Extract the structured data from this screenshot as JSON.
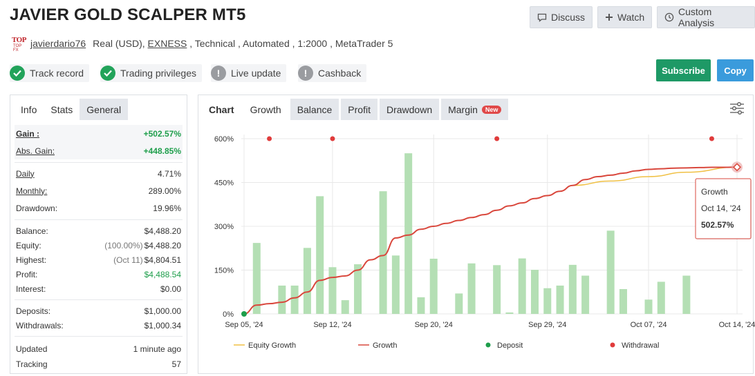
{
  "title": "JAVIER GOLD SCALPER MT5",
  "top_buttons": {
    "discuss": "Discuss",
    "watch": "Watch",
    "custom_analysis": "Custom Analysis"
  },
  "meta": {
    "logo_top": "TOP",
    "logo_bottom": "TOP FX",
    "username": "javierdario76",
    "account_type": "Real (USD), ",
    "broker": "EXNESS",
    "details": " , Technical , Automated , 1:2000 , MetaTrader 5"
  },
  "badges": [
    {
      "label": "Track record",
      "status": "check"
    },
    {
      "label": "Trading privileges",
      "status": "check"
    },
    {
      "label": "Live update",
      "status": "warning"
    },
    {
      "label": "Cashback",
      "status": "warning"
    }
  ],
  "actions": {
    "subscribe": "Subscribe",
    "copy": "Copy"
  },
  "left_tabs": [
    "Info",
    "Stats",
    "General"
  ],
  "stats": {
    "gain_label": "Gain :",
    "gain_value": "+502.57%",
    "abs_gain_label": "Abs. Gain:",
    "abs_gain_value": "+448.85%",
    "daily_label": "Daily",
    "daily_value": "4.71%",
    "monthly_label": "Monthly:",
    "monthly_value": "289.00%",
    "drawdown_label": "Drawdown:",
    "drawdown_value": "19.96%",
    "balance_label": "Balance:",
    "balance_value": "$4,488.20",
    "equity_label": "Equity:",
    "equity_pct": "(100.00%)",
    "equity_value": "$4,488.20",
    "highest_label": "Highest:",
    "highest_date": "(Oct 11)",
    "highest_value": "$4,804.51",
    "profit_label": "Profit:",
    "profit_value": "$4,488.54",
    "interest_label": "Interest:",
    "interest_value": "$0.00",
    "deposits_label": "Deposits:",
    "deposits_value": "$1,000.00",
    "withdrawals_label": "Withdrawals:",
    "withdrawals_value": "$1,000.34",
    "updated_label": "Updated",
    "updated_value": "1 minute ago",
    "tracking_label": "Tracking",
    "tracking_value": "57"
  },
  "chart_tabs": [
    "Chart",
    "Growth",
    "Balance",
    "Profit",
    "Drawdown",
    "Margin"
  ],
  "chart_tab_new_badge": "New",
  "tooltip": {
    "title": "Growth",
    "date": "Oct 14, '24",
    "value": "502.57%"
  },
  "colors": {
    "growth_line": "#d9473c",
    "equity_line": "#f0c043",
    "bars": "#b4dfb4",
    "deposit": "#1e9e4b",
    "withdrawal": "#e03b3b",
    "subscribe": "#1e9966",
    "copy": "#3a9bdc"
  },
  "chart_data": {
    "type": "line",
    "ylim": [
      0,
      600
    ],
    "yticks": [
      "0%",
      "150%",
      "300%",
      "450%",
      "600%"
    ],
    "ytick_values": [
      0,
      150,
      300,
      450,
      600
    ],
    "xtick_labels": [
      "Sep 05, '24",
      "Sep 12, '24",
      "Sep 20, '24",
      "Sep 29, '24",
      "Oct 07, '24",
      "Oct 14, '24"
    ],
    "x_start_label": "Sep 05, '24",
    "x_end_label": "Oct 14, '24",
    "legend": [
      "Equity Growth",
      "Growth",
      "Deposit",
      "Withdrawal"
    ],
    "bars": [
      {
        "date": "Sep 06, '24",
        "value": 243
      },
      {
        "date": "Sep 08, '24",
        "value": 97
      },
      {
        "date": "Sep 09, '24",
        "value": 97
      },
      {
        "date": "Sep 10, '24",
        "value": 226
      },
      {
        "date": "Sep 11, '24",
        "value": 403
      },
      {
        "date": "Sep 12, '24",
        "value": 160
      },
      {
        "date": "Sep 13, '24",
        "value": 47
      },
      {
        "date": "Sep 14, '24",
        "value": 170
      },
      {
        "date": "Sep 16, '24",
        "value": 420
      },
      {
        "date": "Sep 17, '24",
        "value": 200
      },
      {
        "date": "Sep 18, '24",
        "value": 550
      },
      {
        "date": "Sep 19, '24",
        "value": 57
      },
      {
        "date": "Sep 20, '24",
        "value": 189
      },
      {
        "date": "Sep 22, '24",
        "value": 70
      },
      {
        "date": "Sep 23, '24",
        "value": 173
      },
      {
        "date": "Sep 25, '24",
        "value": 167
      },
      {
        "date": "Sep 26, '24",
        "value": 5
      },
      {
        "date": "Sep 27, '24",
        "value": 190
      },
      {
        "date": "Sep 28, '24",
        "value": 151
      },
      {
        "date": "Sep 29, '24",
        "value": 88
      },
      {
        "date": "Sep 30, '24",
        "value": 97
      },
      {
        "date": "Oct 01, '24",
        "value": 168
      },
      {
        "date": "Oct 02, '24",
        "value": 131
      },
      {
        "date": "Oct 04, '24",
        "value": 285
      },
      {
        "date": "Oct 05, '24",
        "value": 85
      },
      {
        "date": "Oct 07, '24",
        "value": 49
      },
      {
        "date": "Oct 08, '24",
        "value": 110
      },
      {
        "date": "Oct 10, '24",
        "value": 131
      }
    ],
    "growth": [
      [
        "Sep 05, '24",
        0
      ],
      [
        "Sep 06, '24",
        30
      ],
      [
        "Sep 07, '24",
        35
      ],
      [
        "Sep 08, '24",
        40
      ],
      [
        "Sep 09, '24",
        55
      ],
      [
        "Sep 10, '24",
        75
      ],
      [
        "Sep 11, '24",
        115
      ],
      [
        "Sep 12, '24",
        125
      ],
      [
        "Sep 13, '24",
        130
      ],
      [
        "Sep 14, '24",
        150
      ],
      [
        "Sep 15, '24",
        185
      ],
      [
        "Sep 16, '24",
        200
      ],
      [
        "Sep 17, '24",
        260
      ],
      [
        "Sep 18, '24",
        270
      ],
      [
        "Sep 19, '24",
        290
      ],
      [
        "Sep 20, '24",
        300
      ],
      [
        "Sep 21, '24",
        310
      ],
      [
        "Sep 22, '24",
        320
      ],
      [
        "Sep 23, '24",
        330
      ],
      [
        "Sep 24, '24",
        340
      ],
      [
        "Sep 25, '24",
        355
      ],
      [
        "Sep 26, '24",
        370
      ],
      [
        "Sep 27, '24",
        380
      ],
      [
        "Sep 28, '24",
        395
      ],
      [
        "Sep 29, '24",
        405
      ],
      [
        "Sep 30, '24",
        420
      ],
      [
        "Oct 01, '24",
        440
      ],
      [
        "Oct 02, '24",
        460
      ],
      [
        "Oct 03, '24",
        470
      ],
      [
        "Oct 04, '24",
        475
      ],
      [
        "Oct 05, '24",
        482
      ],
      [
        "Oct 06, '24",
        490
      ],
      [
        "Oct 07, '24",
        495
      ],
      [
        "Oct 08, '24",
        497
      ],
      [
        "Oct 09, '24",
        499
      ],
      [
        "Oct 10, '24",
        500
      ],
      [
        "Oct 11, '24",
        501
      ],
      [
        "Oct 12, '24",
        502
      ],
      [
        "Oct 13, '24",
        502
      ],
      [
        "Oct 14, '24",
        502.57
      ]
    ],
    "equity_growth": [
      [
        "Oct 01, '24",
        440
      ],
      [
        "Oct 04, '24",
        455
      ],
      [
        "Oct 07, '24",
        470
      ],
      [
        "Oct 10, '24",
        485
      ],
      [
        "Oct 14, '24",
        502.57
      ]
    ],
    "deposits": [
      {
        "date": "Sep 05, '24",
        "value": 0
      }
    ],
    "withdrawals": [
      {
        "date": "Sep 07, '24",
        "value": 600
      },
      {
        "date": "Sep 12, '24",
        "value": 600
      },
      {
        "date": "Sep 25, '24",
        "value": 600
      },
      {
        "date": "Oct 12, '24",
        "value": 600
      }
    ],
    "highlight": {
      "date": "Oct 14, '24",
      "value": 502.57
    }
  }
}
